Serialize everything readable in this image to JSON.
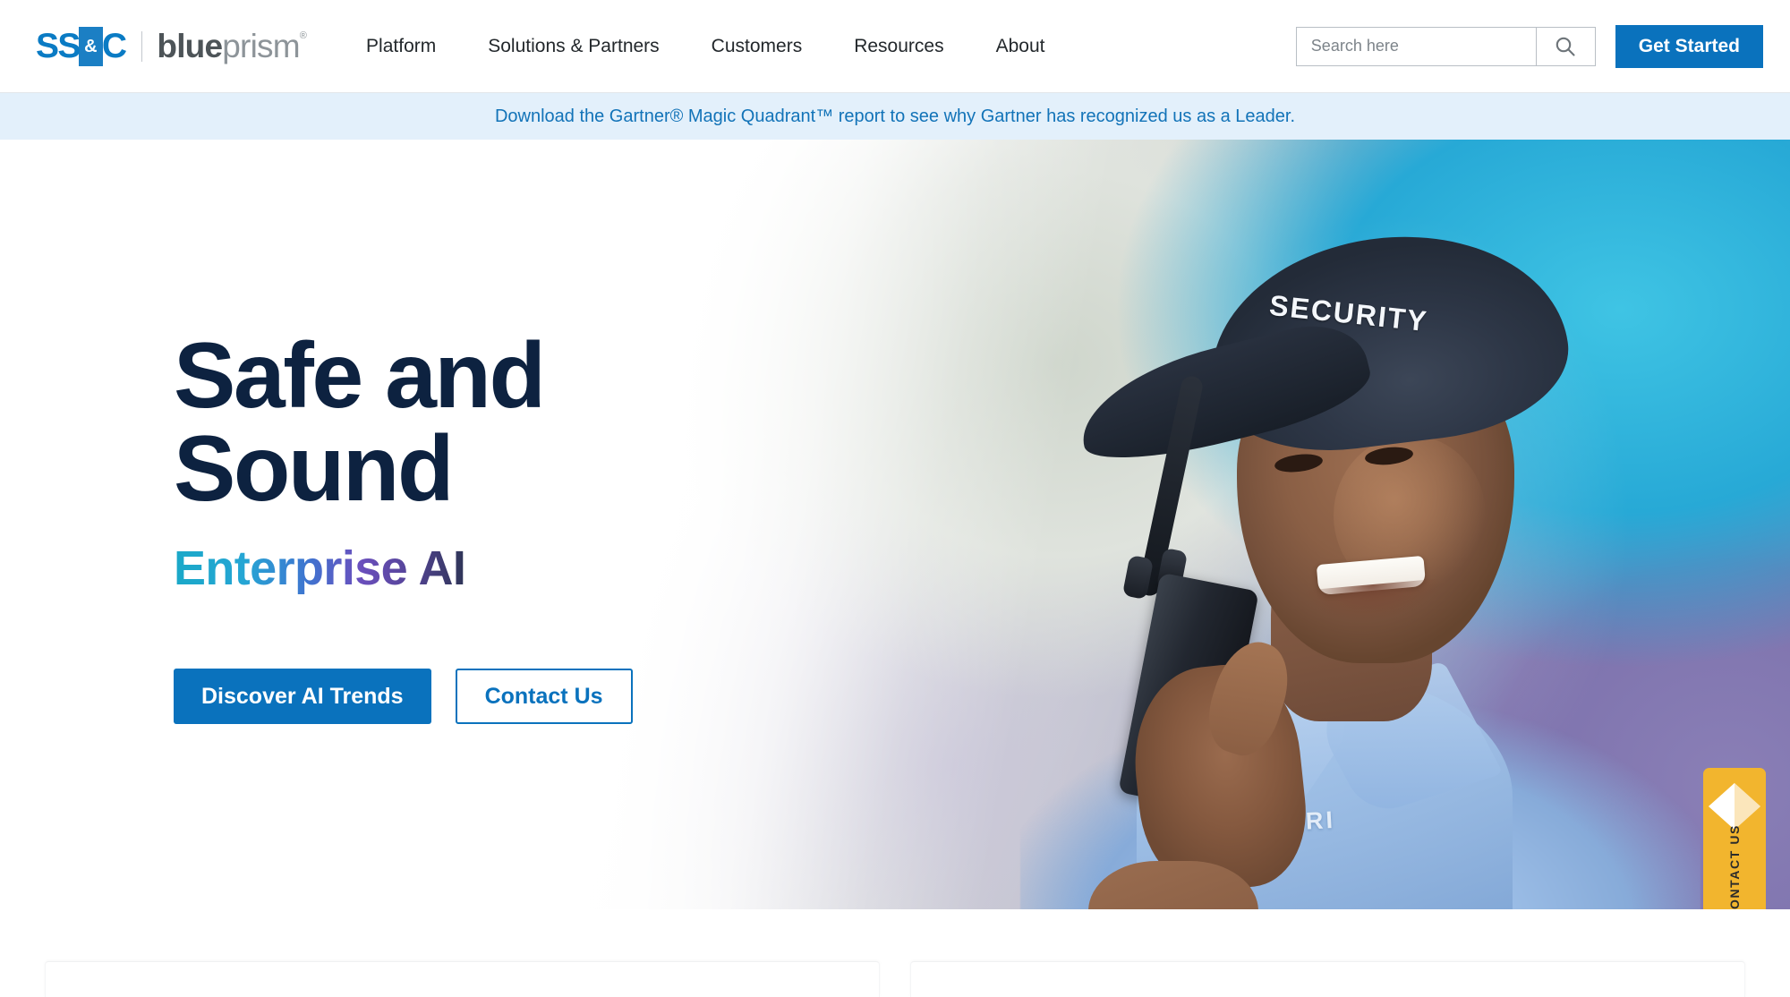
{
  "header": {
    "logo": {
      "ss": "SS",
      "amp": "&",
      "c": "C",
      "blue": "blue",
      "prism": "prism",
      "registered": "®"
    },
    "nav": [
      {
        "label": "Platform"
      },
      {
        "label": "Solutions & Partners"
      },
      {
        "label": "Customers"
      },
      {
        "label": "Resources"
      },
      {
        "label": "About"
      }
    ],
    "search": {
      "placeholder": "Search here",
      "value": "",
      "icon": "search-icon"
    },
    "cta": {
      "label": "Get Started"
    }
  },
  "banner": {
    "text": "Download the Gartner® Magic Quadrant™ report to see why Gartner has recognized us as a Leader."
  },
  "hero": {
    "title_line1": "Safe and",
    "title_line2": "Sound",
    "subtitle": "Enterprise AI",
    "primary_button": "Discover AI Trends",
    "secondary_button": "Contact Us",
    "image_alt_texts": {
      "cap_text": "SECURITY",
      "badge_text": "SECURI"
    }
  },
  "contact_tab": {
    "label": "CONTACT US",
    "icon": "diamond-icon"
  },
  "colors": {
    "brand_blue": "#0a72bd",
    "logo_blue": "#1b7fc4",
    "banner_bg": "#e3f0fb",
    "banner_link": "#1273b8",
    "headline_navy": "#0d2240",
    "tab_yellow": "#f2b52e",
    "gradient_start": "#1aa8c8",
    "gradient_end": "#2e3556"
  }
}
